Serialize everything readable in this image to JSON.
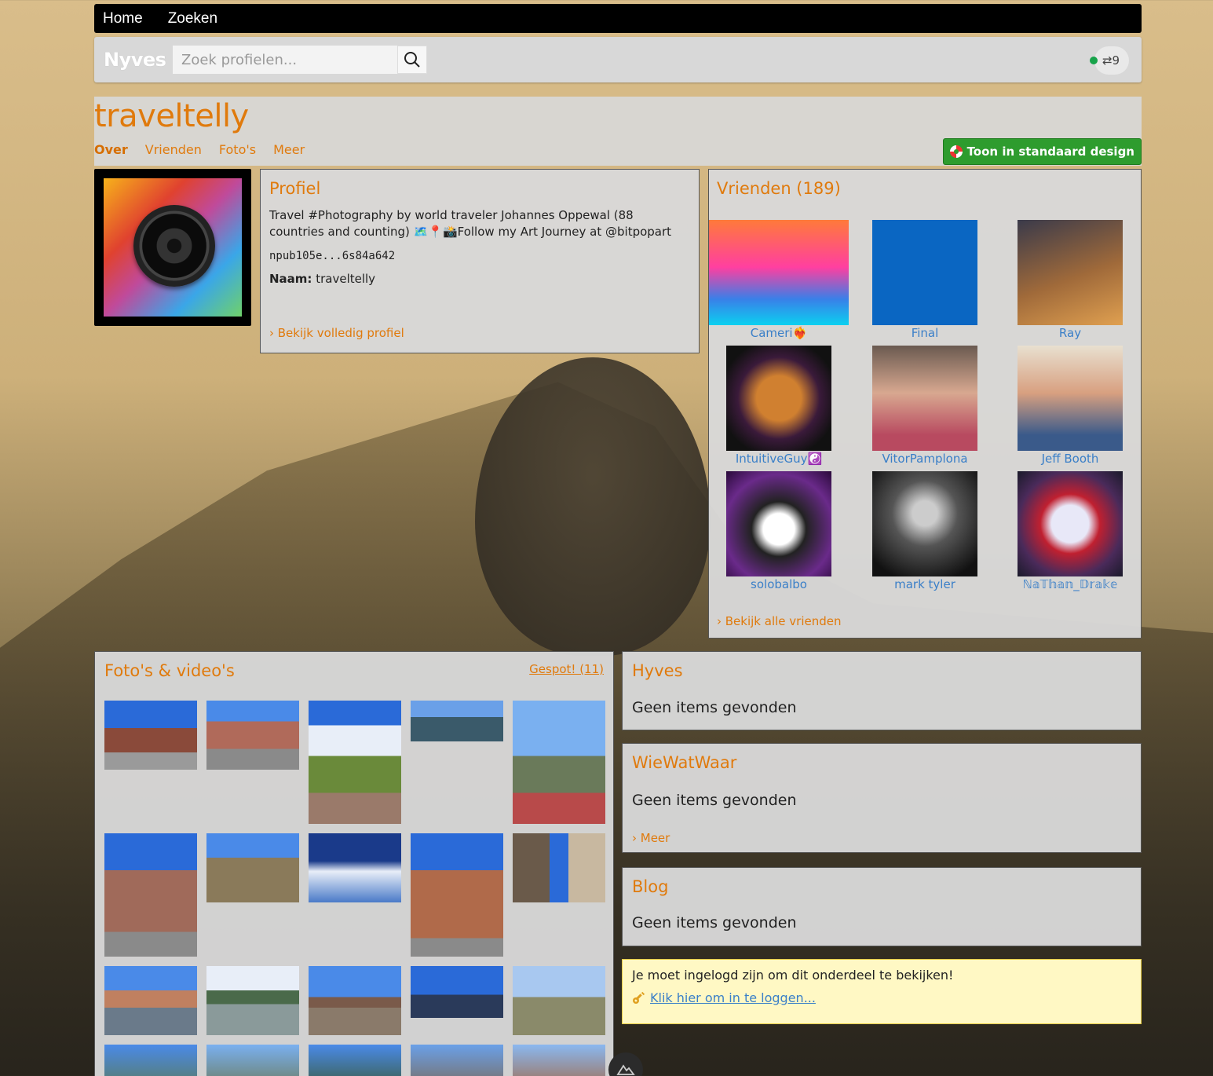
{
  "nav": {
    "home": "Home",
    "search": "Zoeken"
  },
  "searchbar": {
    "logo": "Nyves",
    "placeholder": "Zoek profielen...",
    "relay_count": "⇄9"
  },
  "header": {
    "username": "traveltelly",
    "tabs": [
      {
        "label": "Over",
        "active": true
      },
      {
        "label": "Vrienden"
      },
      {
        "label": "Foto's"
      },
      {
        "label": "Meer"
      }
    ],
    "standard_design_button": "Toon in standaard design"
  },
  "profile": {
    "title": "Profiel",
    "bio": "Travel #Photography by world traveler Johannes Oppewal (88 countries and counting) 🗺️📍📸Follow my Art Journey at @bitpopart",
    "npub": "npub105e...6s84a642",
    "name_label": "Naam:",
    "name_value": "traveltelly",
    "link": "› Bekijk volledig profiel"
  },
  "friends": {
    "title": "Vrienden (189)",
    "items": [
      {
        "name": "Cameri❤️‍🔥",
        "color": "#ff5fa3"
      },
      {
        "name": "Final",
        "color": "#0a66c2"
      },
      {
        "name": "Ray",
        "color": "#a06a3a"
      },
      {
        "name": "IntuitiveGuy☯️",
        "color": "#2a1a2a"
      },
      {
        "name": "VitorPamplona",
        "color": "#b84a60"
      },
      {
        "name": "Jeff Booth",
        "color": "#3a5a8a"
      },
      {
        "name": "solobalbo",
        "color": "#6a2a8a"
      },
      {
        "name": "mark tyler",
        "color": "#555555"
      },
      {
        "name": "ℕ𝕒𝕋𝕙𝕒𝕟_𝔻𝕣𝕒𝕜𝕖",
        "color": "#4a2a5a"
      }
    ],
    "link": "› Bekijk alle vrienden"
  },
  "photos": {
    "title": "Foto's & video's",
    "gespot": "Gespot! (11)"
  },
  "hyves": {
    "title": "Hyves",
    "empty": "Geen items gevonden"
  },
  "wiewatwaar": {
    "title": "WieWatWaar",
    "empty": "Geen items gevonden",
    "more": "› Meer"
  },
  "blog": {
    "title": "Blog",
    "empty": "Geen items gevonden"
  },
  "login": {
    "message": "Je moet ingelogd zijn om dit onderdeel te bekijken!",
    "link": "Klik hier om in te loggen..."
  },
  "colors": {
    "accent": "#e07a0c",
    "link_blue": "#3a7fc8",
    "green_button": "#2e9c2e"
  }
}
